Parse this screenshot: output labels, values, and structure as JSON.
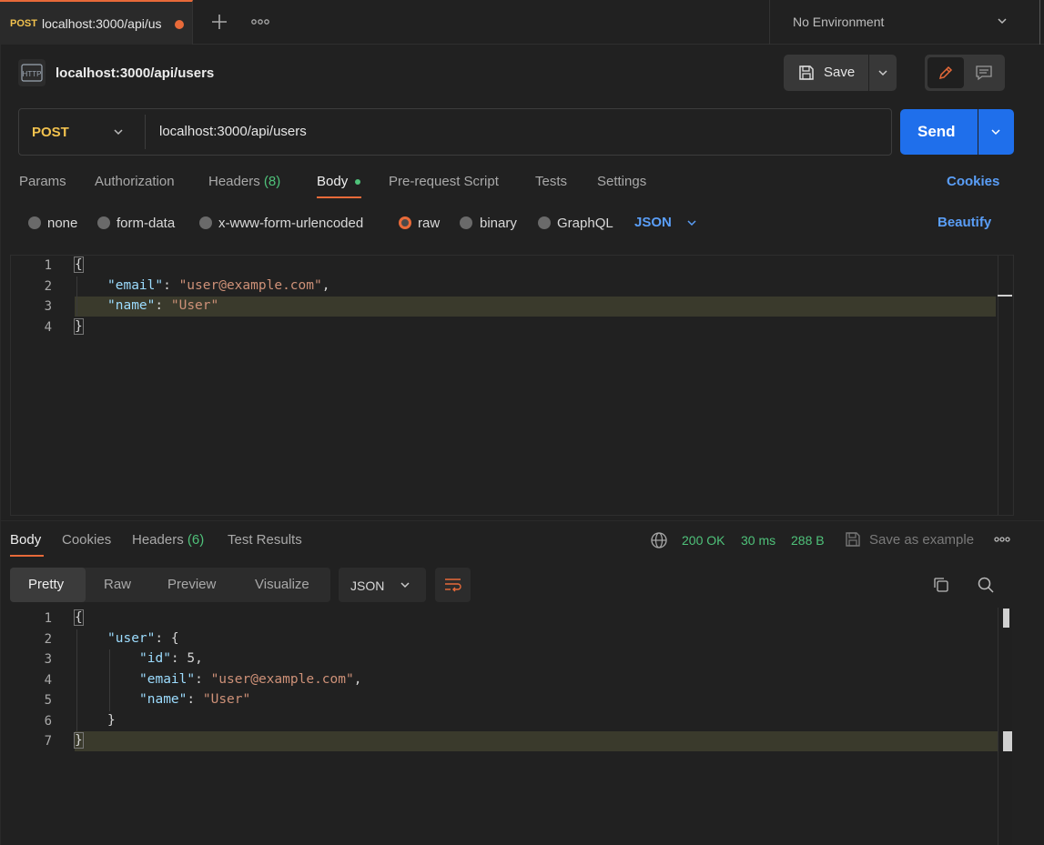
{
  "tabs": {
    "active": {
      "method": "POST",
      "title": "localhost:3000/api/us",
      "unsaved": true
    },
    "new_tab_icon": "plus-icon",
    "more_icon": "ellipsis-icon"
  },
  "environment": {
    "label": "No Environment"
  },
  "request": {
    "icon": "HTTP",
    "title": "localhost:3000/api/users",
    "save_label": "Save",
    "method": "POST",
    "url": "localhost:3000/api/users",
    "send_label": "Send"
  },
  "request_tabs": {
    "params": "Params",
    "authorization": "Authorization",
    "headers": "Headers",
    "headers_count": "(8)",
    "body": "Body",
    "prerequest": "Pre-request Script",
    "tests": "Tests",
    "settings": "Settings",
    "cookies": "Cookies"
  },
  "body_types": {
    "none": "none",
    "form_data": "form-data",
    "urlencoded": "x-www-form-urlencoded",
    "raw": "raw",
    "binary": "binary",
    "graphql": "GraphQL",
    "format": "JSON",
    "beautify": "Beautify",
    "selected": "raw"
  },
  "request_body": {
    "line_numbers": [
      "1",
      "2",
      "3",
      "4"
    ],
    "open": "{",
    "k1": "\"email\"",
    "v1": "\"user@example.com\"",
    "k2": "\"name\"",
    "v2": "\"User\"",
    "close": "}",
    "colon": ": ",
    "comma": ","
  },
  "response_tabs": {
    "body": "Body",
    "cookies": "Cookies",
    "headers": "Headers",
    "headers_count": "(6)",
    "test_results": "Test Results"
  },
  "response_status": {
    "status": "200 OK",
    "time": "30 ms",
    "size": "288 B",
    "save_example": "Save as example"
  },
  "response_view": {
    "pretty": "Pretty",
    "raw": "Raw",
    "preview": "Preview",
    "visualize": "Visualize",
    "format": "JSON"
  },
  "response_body": {
    "line_numbers": [
      "1",
      "2",
      "3",
      "4",
      "5",
      "6",
      "7"
    ],
    "open": "{",
    "user_key": "\"user\"",
    "open2": "{",
    "id_key": "\"id\"",
    "id_val": "5",
    "email_key": "\"email\"",
    "email_val": "\"user@example.com\"",
    "name_key": "\"name\"",
    "name_val": "\"User\"",
    "close2": "}",
    "close": "}",
    "colon": ": ",
    "comma": ","
  },
  "colors": {
    "accent": "#e86a39",
    "send": "#1f6feb",
    "link": "#5a9ef7",
    "success": "#4fc27a",
    "method_post": "#f2c24e"
  }
}
